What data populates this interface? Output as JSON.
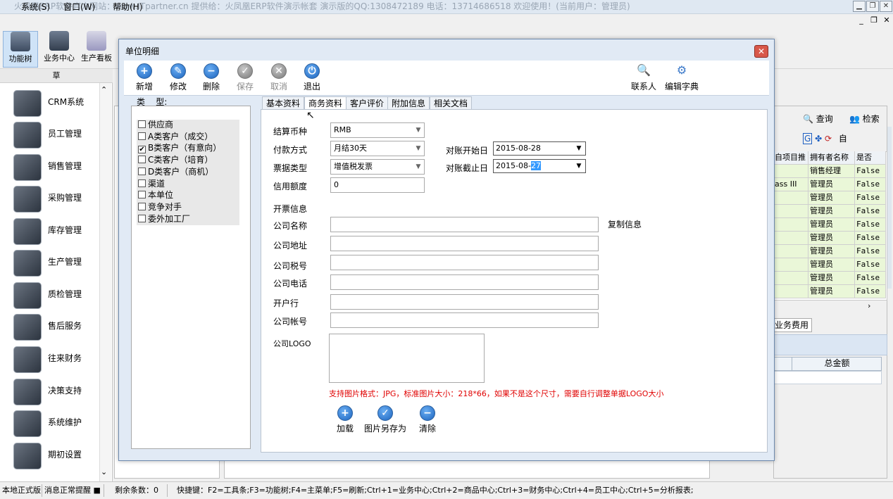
{
  "app": {
    "title": "火凤凰ERP软件官方网站：www.ITpartner.cn  提供给：火凤凰ERP软件演示帐套 演示版的QQ:1308472189 电话：13714686518 欢迎使用！(当前用户：管理员)",
    "menus": [
      "系统(S)",
      "窗口(W)",
      "帮助(H)"
    ]
  },
  "toolbar": {
    "items": [
      {
        "label": "功能树",
        "icon": "tree-icon"
      },
      {
        "label": "业务中心",
        "icon": "business-icon"
      },
      {
        "label": "生产看板",
        "icon": "kanban-icon"
      }
    ]
  },
  "left_panel": {
    "header": "草",
    "items": [
      {
        "label": "CRM系统",
        "icon": "crm-icon"
      },
      {
        "label": "员工管理",
        "icon": "employee-icon"
      },
      {
        "label": "销售管理",
        "icon": "sales-icon"
      },
      {
        "label": "采购管理",
        "icon": "purchase-icon"
      },
      {
        "label": "库存管理",
        "icon": "inventory-icon"
      },
      {
        "label": "生产管理",
        "icon": "production-icon"
      },
      {
        "label": "质检管理",
        "icon": "quality-icon"
      },
      {
        "label": "售后服务",
        "icon": "aftersales-icon"
      },
      {
        "label": "往来财务",
        "icon": "finance-icon"
      },
      {
        "label": "决策支持",
        "icon": "decision-icon"
      },
      {
        "label": "系统维护",
        "icon": "maintenance-icon"
      },
      {
        "label": "期初设置",
        "icon": "initial-setup-icon"
      }
    ]
  },
  "background": {
    "query_label": "查询",
    "search_label": "检索",
    "auto_label": "自",
    "grid_headers": [
      "自项目推",
      "拥有者名称",
      "是否"
    ],
    "grid_rows": [
      [
        "",
        "销售经理",
        "False"
      ],
      [
        "ass III",
        "管理员",
        "False"
      ],
      [
        "",
        "管理员",
        "False"
      ],
      [
        "",
        "管理员",
        "False"
      ],
      [
        "",
        "管理员",
        "False"
      ],
      [
        "",
        "管理员",
        "False"
      ],
      [
        "",
        "管理员",
        "False"
      ],
      [
        "",
        "管理员",
        "False"
      ],
      [
        "",
        "管理员",
        "False"
      ],
      [
        "",
        "管理员",
        "False"
      ]
    ],
    "tab_label": "业务费用",
    "total_header": "总金额"
  },
  "dialog": {
    "title": "单位明细",
    "buttons": [
      {
        "label": "新增",
        "symbol": "+",
        "enabled": true
      },
      {
        "label": "修改",
        "symbol": "✎",
        "enabled": true
      },
      {
        "label": "删除",
        "symbol": "−",
        "enabled": true
      },
      {
        "label": "保存",
        "symbol": "✓",
        "enabled": false
      },
      {
        "label": "取消",
        "symbol": "✕",
        "enabled": false
      },
      {
        "label": "退出",
        "symbol": "⏻",
        "enabled": true
      }
    ],
    "right_buttons": [
      {
        "label": "联系人"
      },
      {
        "label": "编辑字典"
      }
    ],
    "type_label": "类    型:",
    "types": [
      {
        "label": "供应商",
        "checked": false
      },
      {
        "label": "A类客户（成交）",
        "checked": false
      },
      {
        "label": "B类客户（有意向）",
        "checked": true
      },
      {
        "label": "C类客户（培育）",
        "checked": false
      },
      {
        "label": "D类客户（商机）",
        "checked": false
      },
      {
        "label": "渠道",
        "checked": false
      },
      {
        "label": "本单位",
        "checked": false
      },
      {
        "label": "竞争对手",
        "checked": false
      },
      {
        "label": "委外加工厂",
        "checked": false
      }
    ],
    "tabs": [
      "基本资料",
      "商务资料",
      "客户评价",
      "附加信息",
      "相关文档"
    ],
    "active_tab": "商务资料",
    "form": {
      "currency_label": "结算币种",
      "currency_value": "RMB",
      "payment_label": "付款方式",
      "payment_value": "月结30天",
      "invoice_type_label": "票据类型",
      "invoice_type_value": "增值税发票",
      "credit_label": "信用额度",
      "credit_value": "0",
      "start_date_label": "对账开始日",
      "start_date_value": "2015-08-28",
      "end_date_label": "对账截止日",
      "end_date_prefix": "2015-08-",
      "end_date_selected": "27",
      "invoice_section_label": "开票信息",
      "company_name_label": "公司名称",
      "company_address_label": "公司地址",
      "tax_id_label": "公司税号",
      "phone_label": "公司电话",
      "bank_label": "开户行",
      "account_label": "公司帐号",
      "logo_label": "公司LOGO",
      "copy_info_label": "复制信息",
      "hint": "支持图片格式：JPG，标准图片大小：218*66，如果不是这个尺寸，需要自行调整单据LOGO大小"
    },
    "logo_buttons": [
      {
        "label": "加载",
        "symbol": "+"
      },
      {
        "label": "图片另存为",
        "symbol": "✓"
      },
      {
        "label": "清除",
        "symbol": "−"
      }
    ]
  },
  "status_bar": {
    "mode": "本地正式版",
    "message": "消息正常提醒",
    "remaining": "剩余条数：0",
    "shortcuts": "快捷键：F2=工具条;F3=功能树;F4=主菜单;F5=刷新;Ctrl+1=业务中心;Ctrl+2=商品中心;Ctrl+3=财务中心;Ctrl+4=员工中心;Ctrl+5=分析报表;"
  }
}
